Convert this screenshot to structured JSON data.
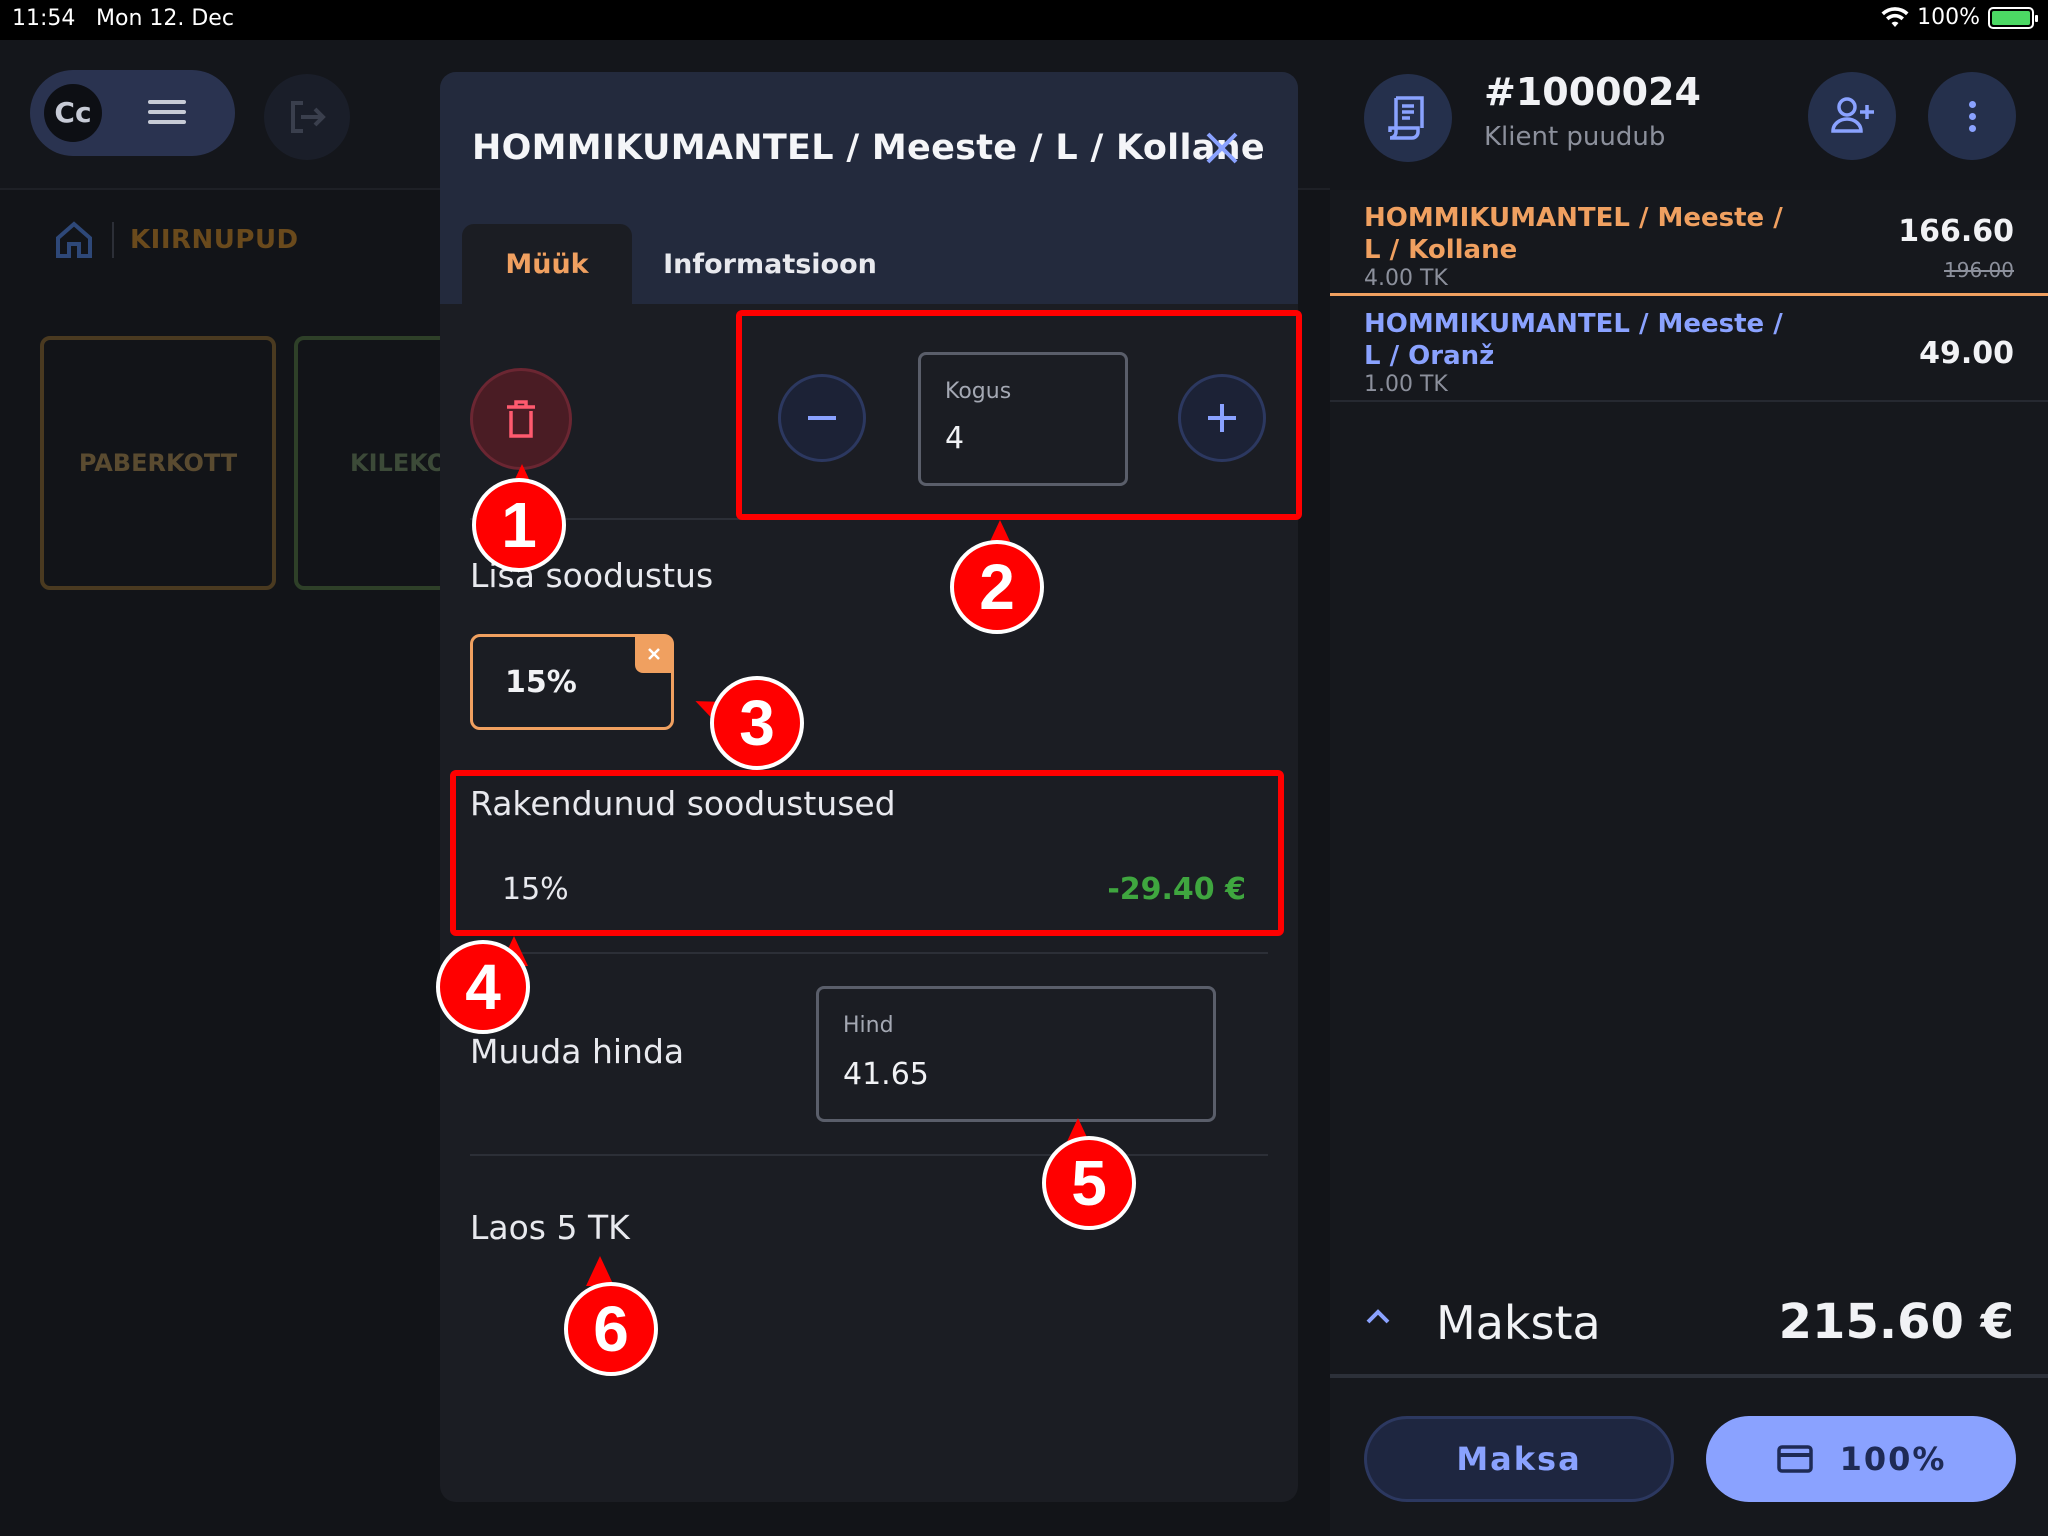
{
  "status_bar": {
    "time": "11:54",
    "date": "Mon 12. Dec",
    "battery": "100%"
  },
  "left": {
    "logo_text": "Cc",
    "breadcrumb": "KIIRNUPUD",
    "quick_buttons": [
      "PABERKOTT",
      "KILEKO"
    ]
  },
  "order": {
    "number": "#1000024",
    "client": "Klient puudub",
    "items": [
      {
        "name_line1": "HOMMIKUMANTEL / Meeste /",
        "name_line2": "L / Kollane",
        "qty": "4.00 TK",
        "price": "166.60",
        "old_price": "196.00"
      },
      {
        "name_line1": "HOMMIKUMANTEL / Meeste /",
        "name_line2": "L / Oranž",
        "qty": "1.00 TK",
        "price": "49.00"
      }
    ],
    "pay_label": "Maksta",
    "total": "215.60 €",
    "pay_button": "Maksa",
    "card_button": "100%"
  },
  "modal": {
    "title": "HOMMIKUMANTEL / Meeste / L / Kollane",
    "tabs": [
      "Müük",
      "Informatsioon"
    ],
    "quantity_label": "Kogus",
    "quantity_value": "4",
    "add_discount_label": "Lisa soodustus",
    "discount_chip": "15%",
    "applied_label": "Rakendunud soodustused",
    "applied_percent": "15%",
    "applied_amount": "-29.40 €",
    "change_price_label": "Muuda hinda",
    "price_label": "Hind",
    "price_value": "41.65",
    "stock_text": "Laos 5 TK"
  },
  "annotations": [
    "1",
    "2",
    "3",
    "4",
    "5",
    "6"
  ],
  "colors": {
    "accent_orange": "#f0a060",
    "accent_blue": "#8aa2ff",
    "annotation_red": "#ff0000",
    "discount_green": "#3fa63f"
  }
}
